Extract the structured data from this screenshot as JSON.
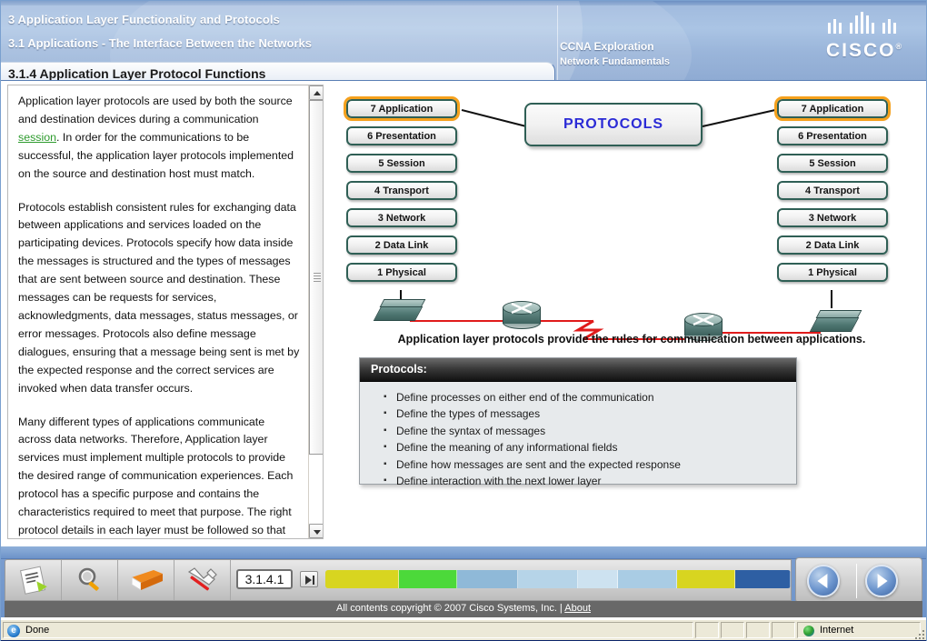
{
  "header": {
    "chapter": "3 Application Layer Functionality and Protocols",
    "section": "3.1 Applications - The Interface Between the Networks",
    "page_title": "3.1.4 Application Layer Protocol Functions",
    "course": "CCNA Exploration",
    "course_sub": "Network Fundamentals",
    "brand": "CISCO",
    "brand_reg": "®",
    "logo_icon": "cisco-bridge-logo"
  },
  "text_panel": {
    "paragraphs": [
      {
        "before_link": "Application layer protocols are used by both the source and destination devices during a communication ",
        "link": "session",
        "after_link": ". In order for the communications to be successful, the application layer protocols implemented on the source and destination host must match."
      },
      {
        "text": "Protocols establish consistent rules for exchanging data between applications and services loaded on the participating devices. Protocols specify how data inside the messages is structured and the types of messages that are sent between source and destination. These messages can be requests for services, acknowledgments, data messages, status messages, or error messages. Protocols also define message dialogues, ensuring that a message being sent is met by the expected response and the correct services are invoked when data transfer occurs."
      },
      {
        "text": "Many different types of applications communicate across data networks. Therefore, Application layer services must implement multiple protocols to provide the desired range of communication experiences. Each protocol has a specific purpose and contains the characteristics required to meet that purpose. The right protocol details in each layer must be followed so that the functions at one layer interface properly with the services in the lower"
      }
    ],
    "scrollbar": {
      "up_icon": "scroll-up-arrow",
      "down_icon": "scroll-down-arrow"
    }
  },
  "diagram": {
    "protocols_box_label": "PROTOCOLS",
    "layers": [
      "7 Application",
      "6 Presentation",
      "5 Session",
      "4 Transport",
      "3 Network",
      "2 Data Link",
      "1 Physical"
    ],
    "highlighted_layer": "7 Application",
    "caption": "Application layer protocols provide the rules for communication between applications.",
    "devices": [
      "switch-left",
      "router-left",
      "router-right",
      "switch-right"
    ],
    "colors": {
      "layer_border": "#2f5f55",
      "highlight": "#f5a11d",
      "protocols_text": "#2b2bd6",
      "link_line": "#e01b1b"
    }
  },
  "protocols_panel": {
    "title": "Protocols:",
    "items": [
      "Define processes on either end of the communication",
      "Define the types of messages",
      "Define the syntax of messages",
      "Define the meaning of any informational fields",
      "Define how messages are sent and the expected response",
      "Define interaction with the next lower layer"
    ]
  },
  "toolbar": {
    "buttons": [
      {
        "name": "notes-button",
        "icon": "notepad-icon"
      },
      {
        "name": "search-button",
        "icon": "magnifier-icon"
      },
      {
        "name": "glossary-button",
        "icon": "orange-book-icon"
      },
      {
        "name": "tools-button",
        "icon": "hammer-wrench-icon"
      }
    ],
    "page_field_value": "3.1.4.1",
    "go_button_icon": "go-to-page-icon",
    "progress_segments": [
      {
        "color": "#d8d520",
        "width": 88
      },
      {
        "color": "#4cd93a",
        "width": 70
      },
      {
        "color": "#8fb9d8",
        "width": 72
      },
      {
        "color": "#b6d4e8",
        "width": 72
      },
      {
        "color": "#cde2f0",
        "width": 48
      },
      {
        "color": "#a9cce4",
        "width": 70
      },
      {
        "color": "#d8d520",
        "width": 70
      },
      {
        "color": "#2e5fa3",
        "width": 66
      }
    ],
    "prev_button_icon": "previous-arrow-icon",
    "next_button_icon": "next-arrow-icon"
  },
  "footer": {
    "copyright": "All contents copyright © 2007 Cisco Systems, Inc. | ",
    "about_link": "About"
  },
  "status_bar": {
    "message": "Done",
    "zone": "Internet",
    "browser_icon": "internet-explorer-icon",
    "zone_icon": "globe-icon"
  }
}
